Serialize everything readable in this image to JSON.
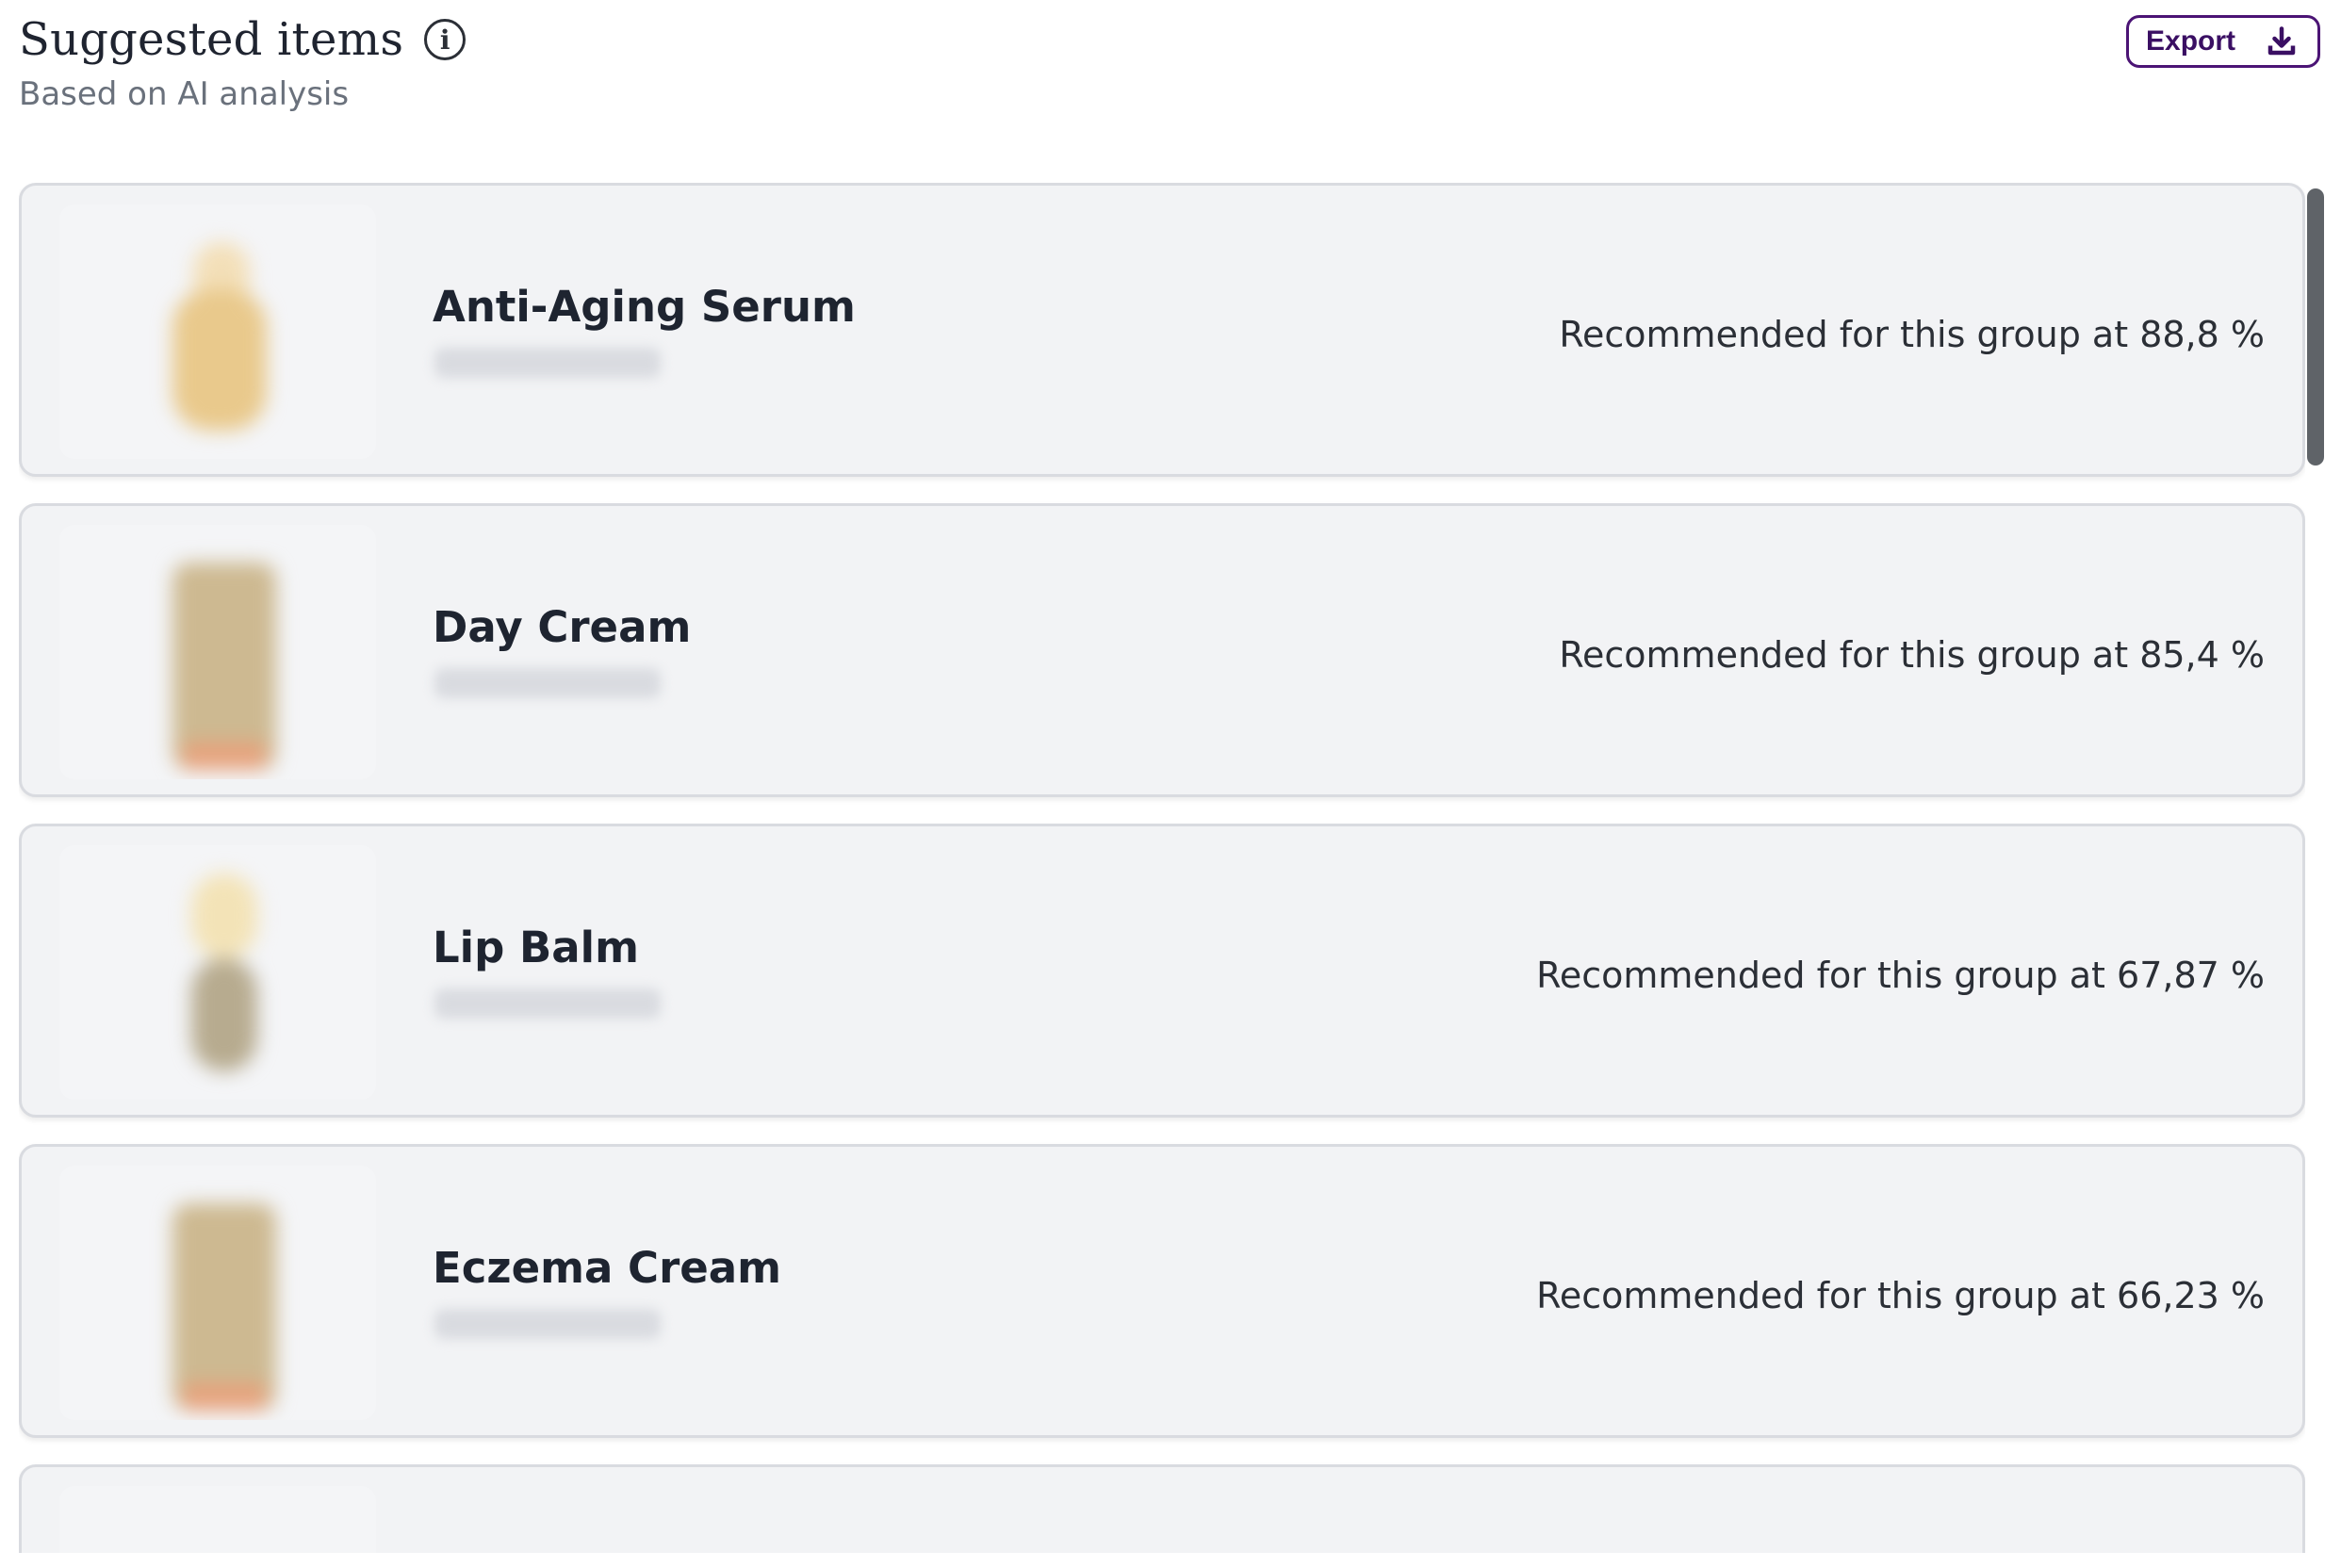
{
  "header": {
    "title": "Suggested items",
    "subtitle": "Based on AI analysis",
    "export_label": "Export"
  },
  "items": [
    {
      "name": "Anti-Aging Serum",
      "recommendation": "Recommended for this group at 88,8 %"
    },
    {
      "name": "Day Cream",
      "recommendation": "Recommended for this group at 85,4 %"
    },
    {
      "name": "Lip Balm",
      "recommendation": "Recommended for this group at 67,87 %"
    },
    {
      "name": "Eczema Cream",
      "recommendation": "Recommended for this group at 66,23 %"
    }
  ],
  "colors": {
    "accent": "#4b1475",
    "card_bg": "#f2f3f5",
    "card_border": "#d9dbe0"
  },
  "icons": {
    "info": "info-icon",
    "export": "download-icon"
  }
}
